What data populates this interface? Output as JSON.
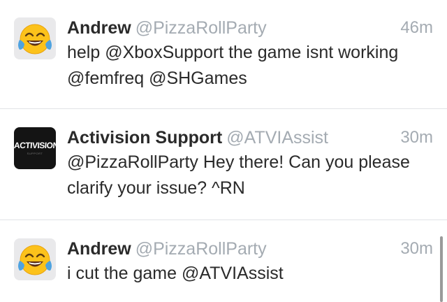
{
  "tweets": [
    {
      "name": "Andrew",
      "handle": "@PizzaRollParty",
      "time": "46m",
      "text": "help @XboxSupport the game isnt working @femfreq @SHGames",
      "avatar_icon": "tears-of-joy-emoji-icon"
    },
    {
      "name": "Activision Support",
      "handle": "@ATVIAssist",
      "time": "30m",
      "text": "@PizzaRollParty Hey there! Can you please clarify your issue? ^RN",
      "avatar_icon": "activision-logo-icon",
      "avatar_logo_text": "ACTIVISION.",
      "avatar_logo_subtext": "SUPPORT"
    },
    {
      "name": "Andrew",
      "handle": "@PizzaRollParty",
      "time": "30m",
      "text": "i cut the game @ATVIAssist",
      "avatar_icon": "tears-of-joy-emoji-icon"
    }
  ],
  "colors": {
    "name_text": "#2a2a2a",
    "secondary_text": "#a4abb2",
    "divider": "#e1e3e6",
    "emoji_face": "#fcc21b",
    "emoji_tears": "#4fa3e0"
  }
}
